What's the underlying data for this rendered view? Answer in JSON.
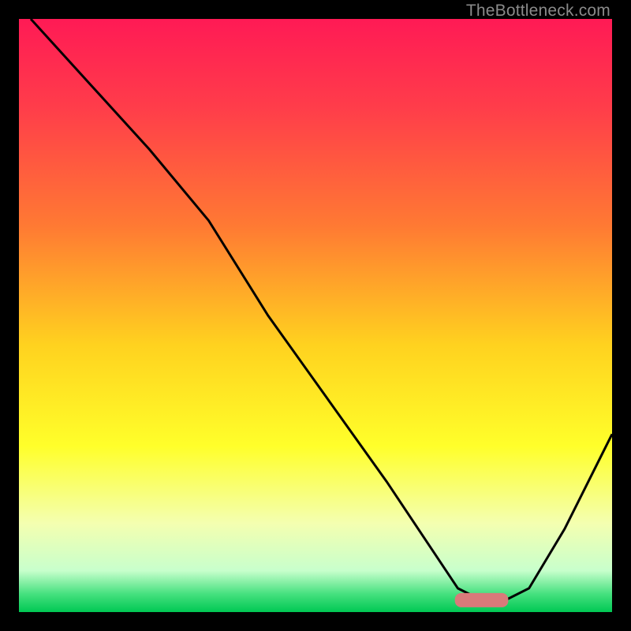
{
  "watermark": "TheBottleneck.com",
  "chart_data": {
    "type": "line",
    "title": "",
    "xlabel": "",
    "ylabel": "",
    "xlim": [
      0,
      100
    ],
    "ylim": [
      0,
      100
    ],
    "gradient_stops": [
      {
        "offset": 0.0,
        "color": "#ff1a55"
      },
      {
        "offset": 0.15,
        "color": "#ff3d4a"
      },
      {
        "offset": 0.35,
        "color": "#ff7a33"
      },
      {
        "offset": 0.55,
        "color": "#ffd21f"
      },
      {
        "offset": 0.72,
        "color": "#ffff2a"
      },
      {
        "offset": 0.85,
        "color": "#f4ffb0"
      },
      {
        "offset": 0.93,
        "color": "#c8ffcc"
      },
      {
        "offset": 0.97,
        "color": "#44e07e"
      },
      {
        "offset": 1.0,
        "color": "#00c853"
      }
    ],
    "series": [
      {
        "name": "curve",
        "x": [
          2,
          12,
          22,
          32,
          42,
          52,
          62,
          70,
          74,
          78,
          82,
          86,
          92,
          100
        ],
        "y": [
          100,
          89,
          78,
          66,
          50,
          36,
          22,
          10,
          4,
          2,
          2,
          4,
          14,
          30
        ]
      }
    ],
    "marker": {
      "name": "optimal-band",
      "x_center": 78,
      "y": 2,
      "width": 9,
      "height": 2.4,
      "color": "#d97a7a"
    }
  }
}
